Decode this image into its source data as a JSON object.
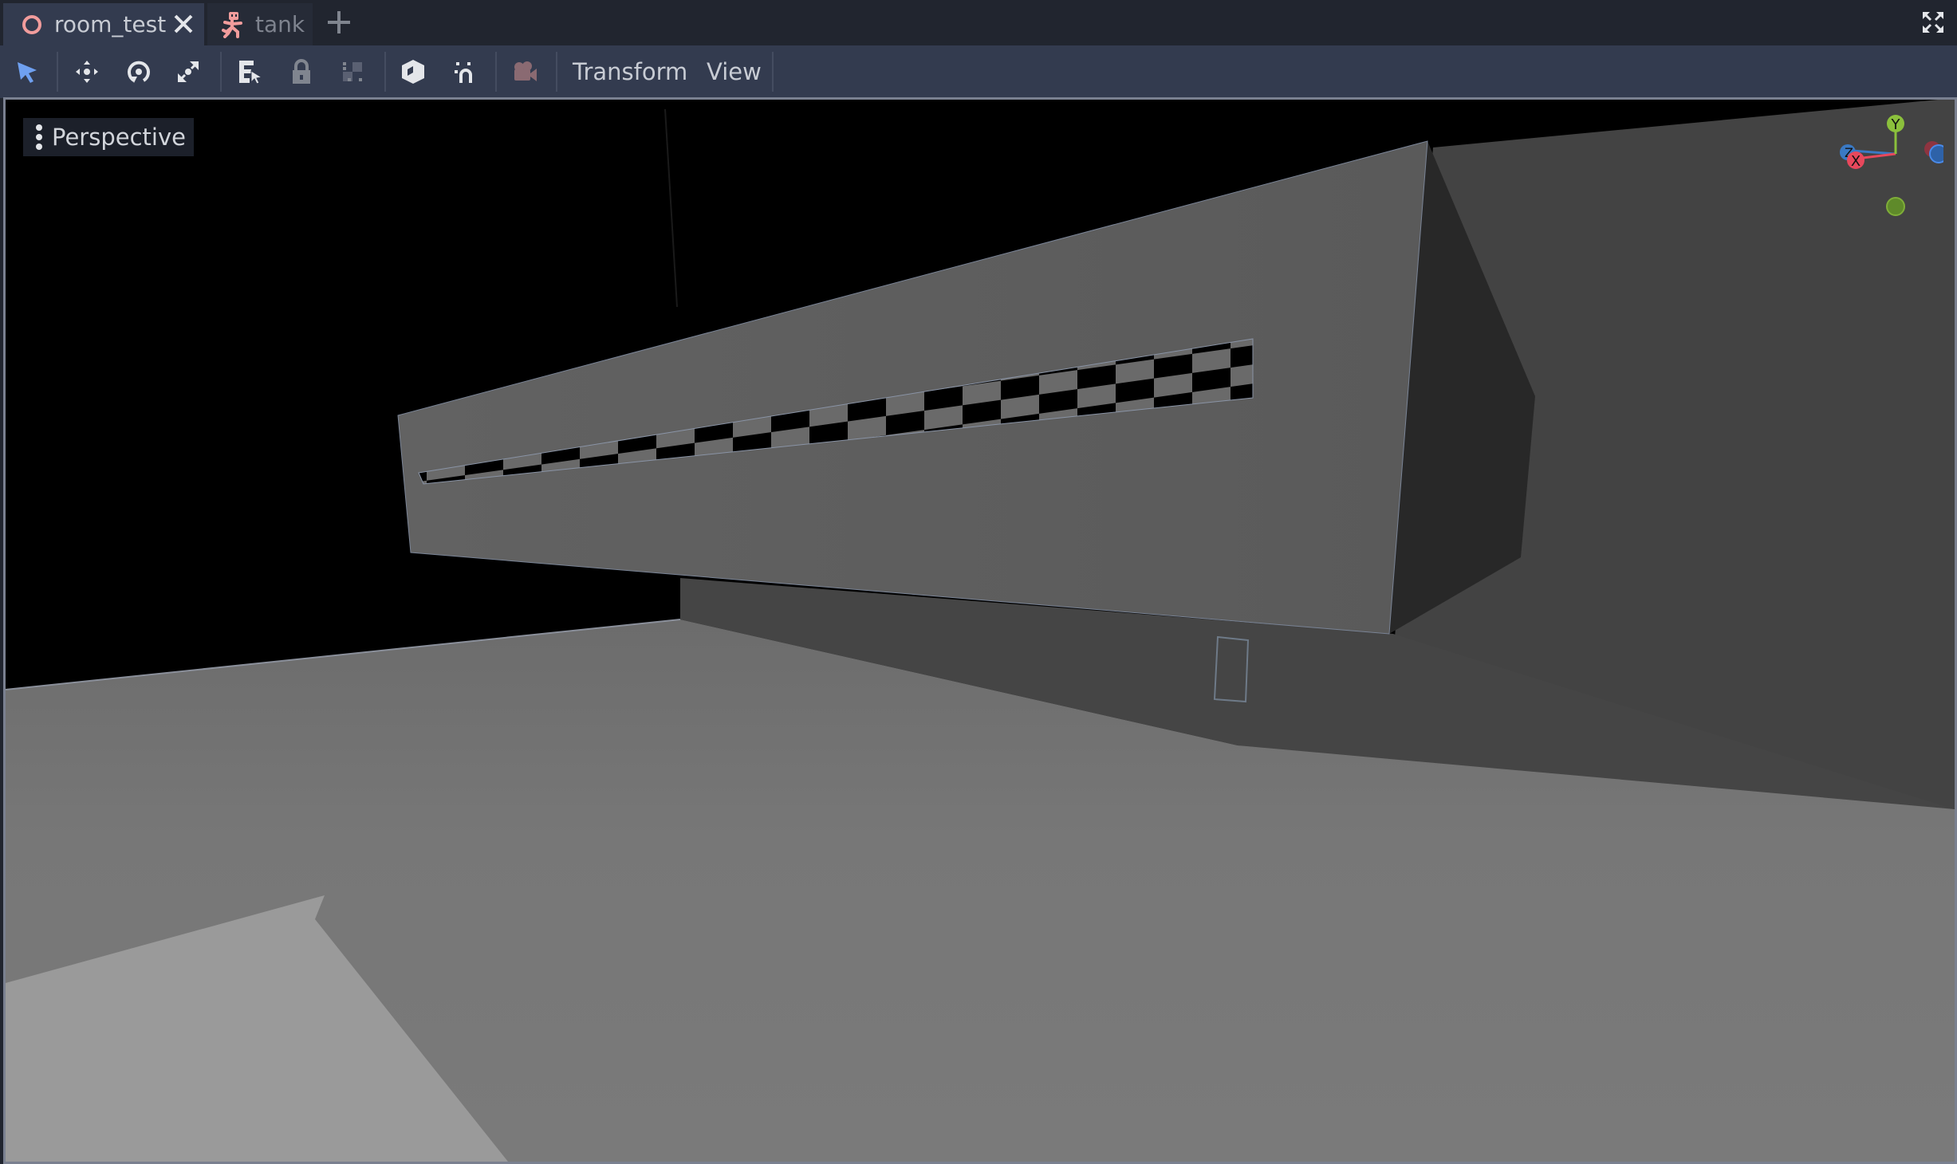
{
  "tabs": [
    {
      "label": "room_test",
      "icon": "node3d-ring-icon",
      "active": true,
      "closable": true
    },
    {
      "label": "tank",
      "icon": "character-body-icon",
      "active": false
    }
  ],
  "tabbar": {
    "add_icon": "plus-icon",
    "fullscreen_icon": "distraction-free-icon"
  },
  "toolbar": {
    "tools": [
      {
        "name": "select-tool",
        "icon": "select-arrow-icon",
        "active": true
      },
      {
        "name": "move-tool",
        "icon": "move-icon"
      },
      {
        "name": "rotate-tool",
        "icon": "rotate-icon"
      },
      {
        "name": "scale-tool",
        "icon": "scale-icon"
      },
      {
        "name": "list-select-tool",
        "icon": "list-select-icon"
      },
      {
        "name": "lock-tool",
        "icon": "lock-icon"
      },
      {
        "name": "group-tool",
        "icon": "group-icon"
      },
      {
        "name": "local-space-toggle",
        "icon": "object-cube-icon"
      },
      {
        "name": "snap-toggle",
        "icon": "snap-magnet-icon"
      },
      {
        "name": "camera-preview-toggle",
        "icon": "camera-icon"
      }
    ],
    "menus": [
      "Transform",
      "View"
    ]
  },
  "viewport": {
    "mode_label": "Perspective",
    "gizmo": {
      "axes": [
        "X",
        "Y",
        "Z"
      ],
      "colors": {
        "x": "#e8485c",
        "y": "#8bc03c",
        "z": "#3a79c4"
      }
    }
  },
  "colors": {
    "accent": "#6fa0f0",
    "tab_icon": "#f19c9c",
    "panel": "#333b4f",
    "base": "#21252f"
  }
}
